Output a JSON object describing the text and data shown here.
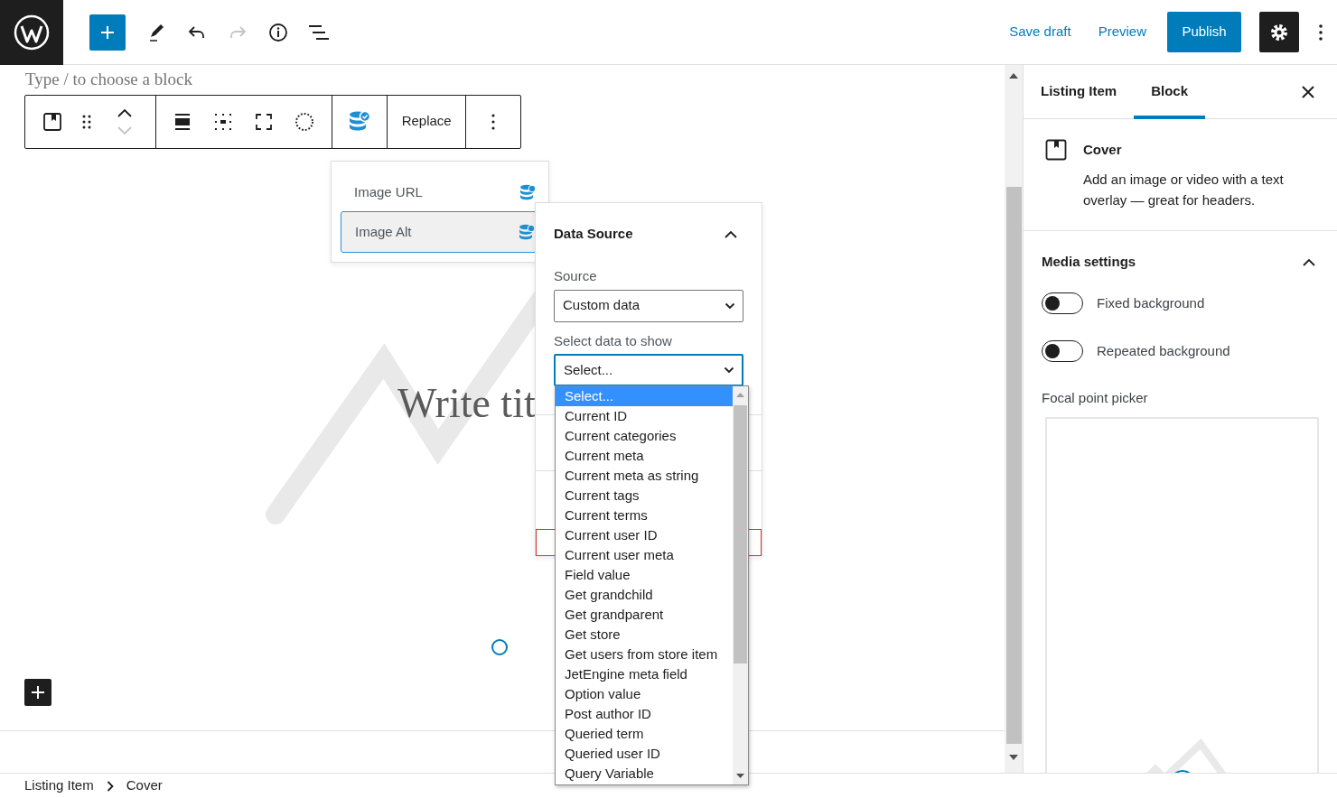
{
  "topbar": {
    "redo_disabled": true,
    "settings_open": true,
    "actions": [
      {
        "label": "Save draft",
        "kind": "link"
      },
      {
        "label": "Preview",
        "kind": "link"
      },
      {
        "label": "Publish",
        "kind": "primary"
      }
    ]
  },
  "editor": {
    "block_placeholder": "Type / to choose a block",
    "move_down_disabled": true,
    "replace_label": "Replace",
    "cover_title": "Write tit"
  },
  "dynamic_fields": [
    {
      "label": "Image URL",
      "selected": false
    },
    {
      "label": "Image Alt",
      "selected": true
    }
  ],
  "data_source": {
    "title": "Data Source",
    "expanded": true,
    "fields": [
      {
        "label": "Source",
        "value": "Custom data",
        "focused": false
      },
      {
        "label": "Select data to show",
        "value": "Select...",
        "focused": true
      }
    ],
    "options": [
      {
        "label": "Select...",
        "selected": true
      },
      {
        "label": "Current ID",
        "selected": false
      },
      {
        "label": "Current categories",
        "selected": false
      },
      {
        "label": "Current meta",
        "selected": false
      },
      {
        "label": "Current meta as string",
        "selected": false
      },
      {
        "label": "Current tags",
        "selected": false
      },
      {
        "label": "Current terms",
        "selected": false
      },
      {
        "label": "Current user ID",
        "selected": false
      },
      {
        "label": "Current user meta",
        "selected": false
      },
      {
        "label": "Field value",
        "selected": false
      },
      {
        "label": "Get grandchild",
        "selected": false
      },
      {
        "label": "Get grandparent",
        "selected": false
      },
      {
        "label": "Get store",
        "selected": false
      },
      {
        "label": "Get users from store item",
        "selected": false
      },
      {
        "label": "JetEngine meta field",
        "selected": false
      },
      {
        "label": "Option value",
        "selected": false
      },
      {
        "label": "Post author ID",
        "selected": false
      },
      {
        "label": "Queried term",
        "selected": false
      },
      {
        "label": "Queried user ID",
        "selected": false
      },
      {
        "label": "Query Variable",
        "selected": false
      }
    ]
  },
  "sidebar": {
    "tabs": [
      {
        "label": "Listing Item",
        "selected": false
      },
      {
        "label": "Block",
        "selected": true
      }
    ],
    "block": {
      "title": "Cover",
      "description": "Add an image or video with a text overlay — great for headers."
    },
    "panel": {
      "title": "Media settings",
      "expanded": true,
      "toggles": [
        {
          "label": "Fixed background",
          "on": false
        },
        {
          "label": "Repeated background",
          "on": false
        }
      ],
      "focal_point_label": "Focal point picker"
    }
  },
  "breadcrumbs": [
    "Listing Item",
    "Cover"
  ]
}
